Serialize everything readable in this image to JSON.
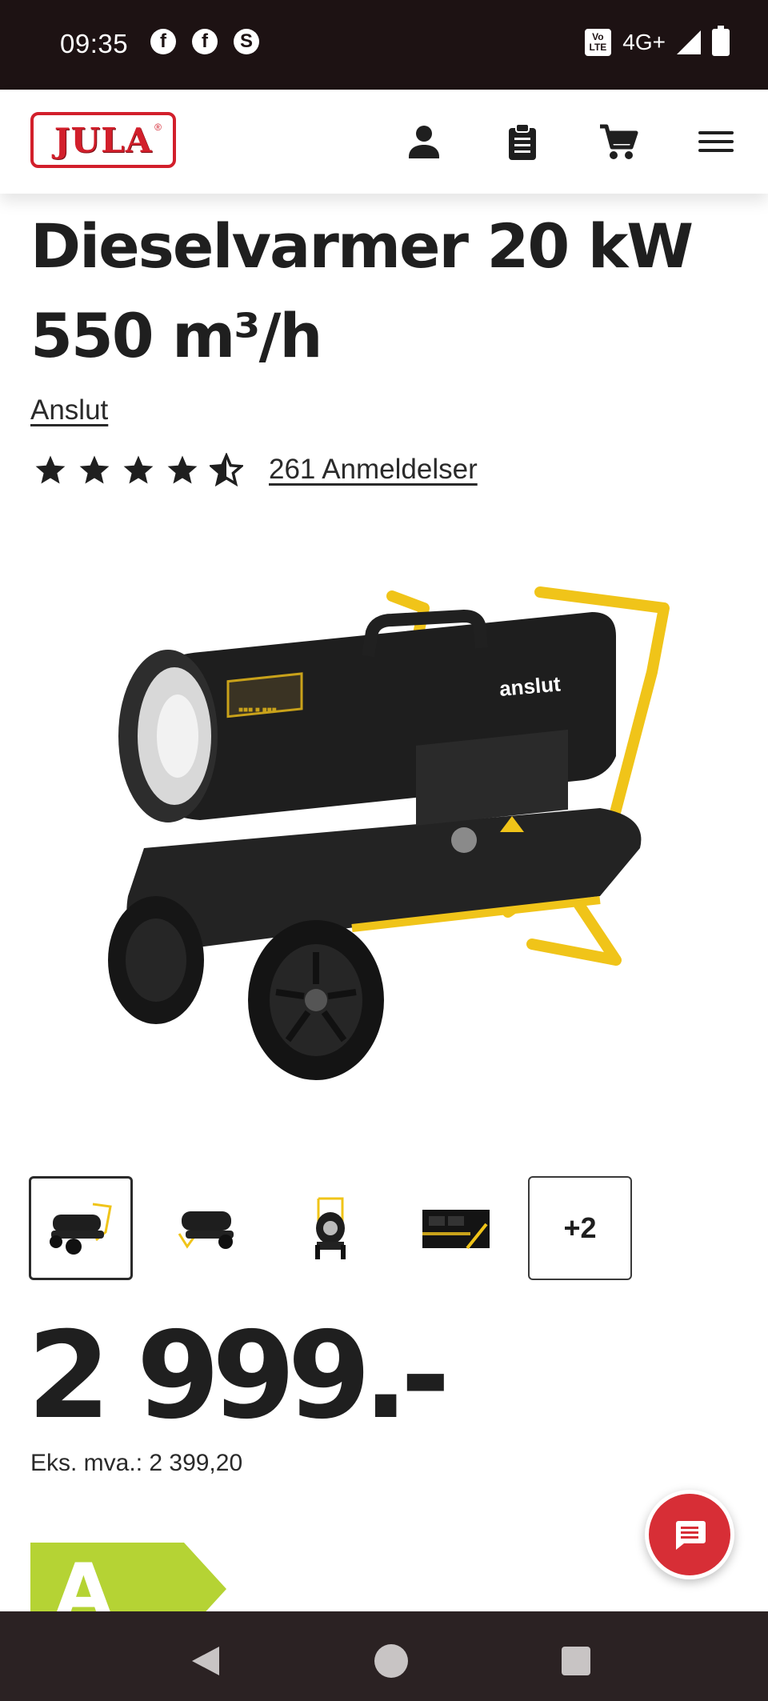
{
  "status_bar": {
    "time": "09:35",
    "network": "4G+",
    "volte_top": "Vo",
    "volte_bottom": "LTE",
    "left_icons": [
      "facebook-icon",
      "facebook-icon",
      "sync-icon"
    ]
  },
  "header": {
    "logo_text": "JULA",
    "logo_mark": "®",
    "icons": [
      "person-icon",
      "clipboard-icon",
      "cart-icon",
      "menu-icon"
    ]
  },
  "product": {
    "title": "Dieselvarmer 20 kW 550 m³/h",
    "brand": "Anslut",
    "rating_value": 4.5,
    "rating_max": 5,
    "reviews_label": "261 Anmeldelser",
    "image_brand_text": "anslut",
    "image_label": "■■■ ■ ■■■",
    "thumbnails_more": "+2",
    "price": "2 999.-",
    "price_ex_vat": "Eks. mva.: 2 399,20",
    "energy_class": "A"
  },
  "colors": {
    "status_bar": "#1d1213",
    "brand_red": "#d21f2b",
    "chat_red": "#d72e36",
    "energy_green": "#b5d334",
    "nav_bar": "#2b2223"
  }
}
